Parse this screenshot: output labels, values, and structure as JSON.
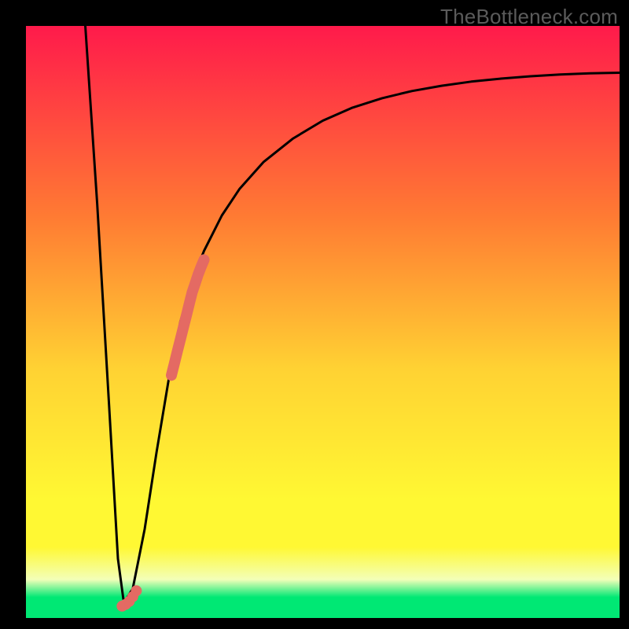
{
  "watermark": "TheBottleneck.com",
  "colors": {
    "bg_black": "#000000",
    "grad_top": "#ff1a4b",
    "grad_mid1": "#ff7a33",
    "grad_mid2": "#ffd233",
    "grad_yellow": "#fff833",
    "grad_pale": "#f3ffb8",
    "grad_green": "#00e874",
    "curve": "#000000",
    "marker": "#e46a63"
  },
  "chart_data": {
    "type": "line",
    "title": "",
    "xlabel": "",
    "ylabel": "",
    "xlim": [
      0,
      100
    ],
    "ylim": [
      0,
      100
    ],
    "grid": false,
    "series": [
      {
        "name": "bottleneck-curve",
        "x": [
          10,
          12,
          14,
          15.5,
          16.5,
          18,
          20,
          22,
          24,
          26,
          28,
          30,
          33,
          36,
          40,
          45,
          50,
          55,
          60,
          65,
          70,
          75,
          80,
          85,
          90,
          95,
          100
        ],
        "y": [
          100,
          70,
          36,
          10,
          2.5,
          5,
          15,
          28,
          40,
          50,
          57,
          62,
          68,
          72.5,
          77,
          81,
          84,
          86.2,
          87.8,
          89,
          89.9,
          90.6,
          91.1,
          91.5,
          91.8,
          92,
          92.1
        ]
      }
    ],
    "markers": [
      {
        "name": "marker-set-low",
        "style": "round",
        "xy": [
          [
            16.2,
            2.0
          ],
          [
            16.8,
            2.3
          ],
          [
            17.4,
            2.8
          ],
          [
            18.0,
            3.6
          ],
          [
            18.6,
            4.6
          ]
        ]
      },
      {
        "name": "marker-set-rise",
        "style": "thick-stroke",
        "xy": [
          [
            24.5,
            41
          ],
          [
            25.0,
            43
          ],
          [
            25.5,
            45
          ],
          [
            26.0,
            47
          ],
          [
            26.5,
            49
          ],
          [
            27.0,
            51
          ],
          [
            27.5,
            53
          ],
          [
            28.0,
            55
          ],
          [
            28.5,
            56.5
          ],
          [
            29.0,
            58
          ],
          [
            29.5,
            59.3
          ],
          [
            30.0,
            60.5
          ]
        ]
      }
    ]
  }
}
